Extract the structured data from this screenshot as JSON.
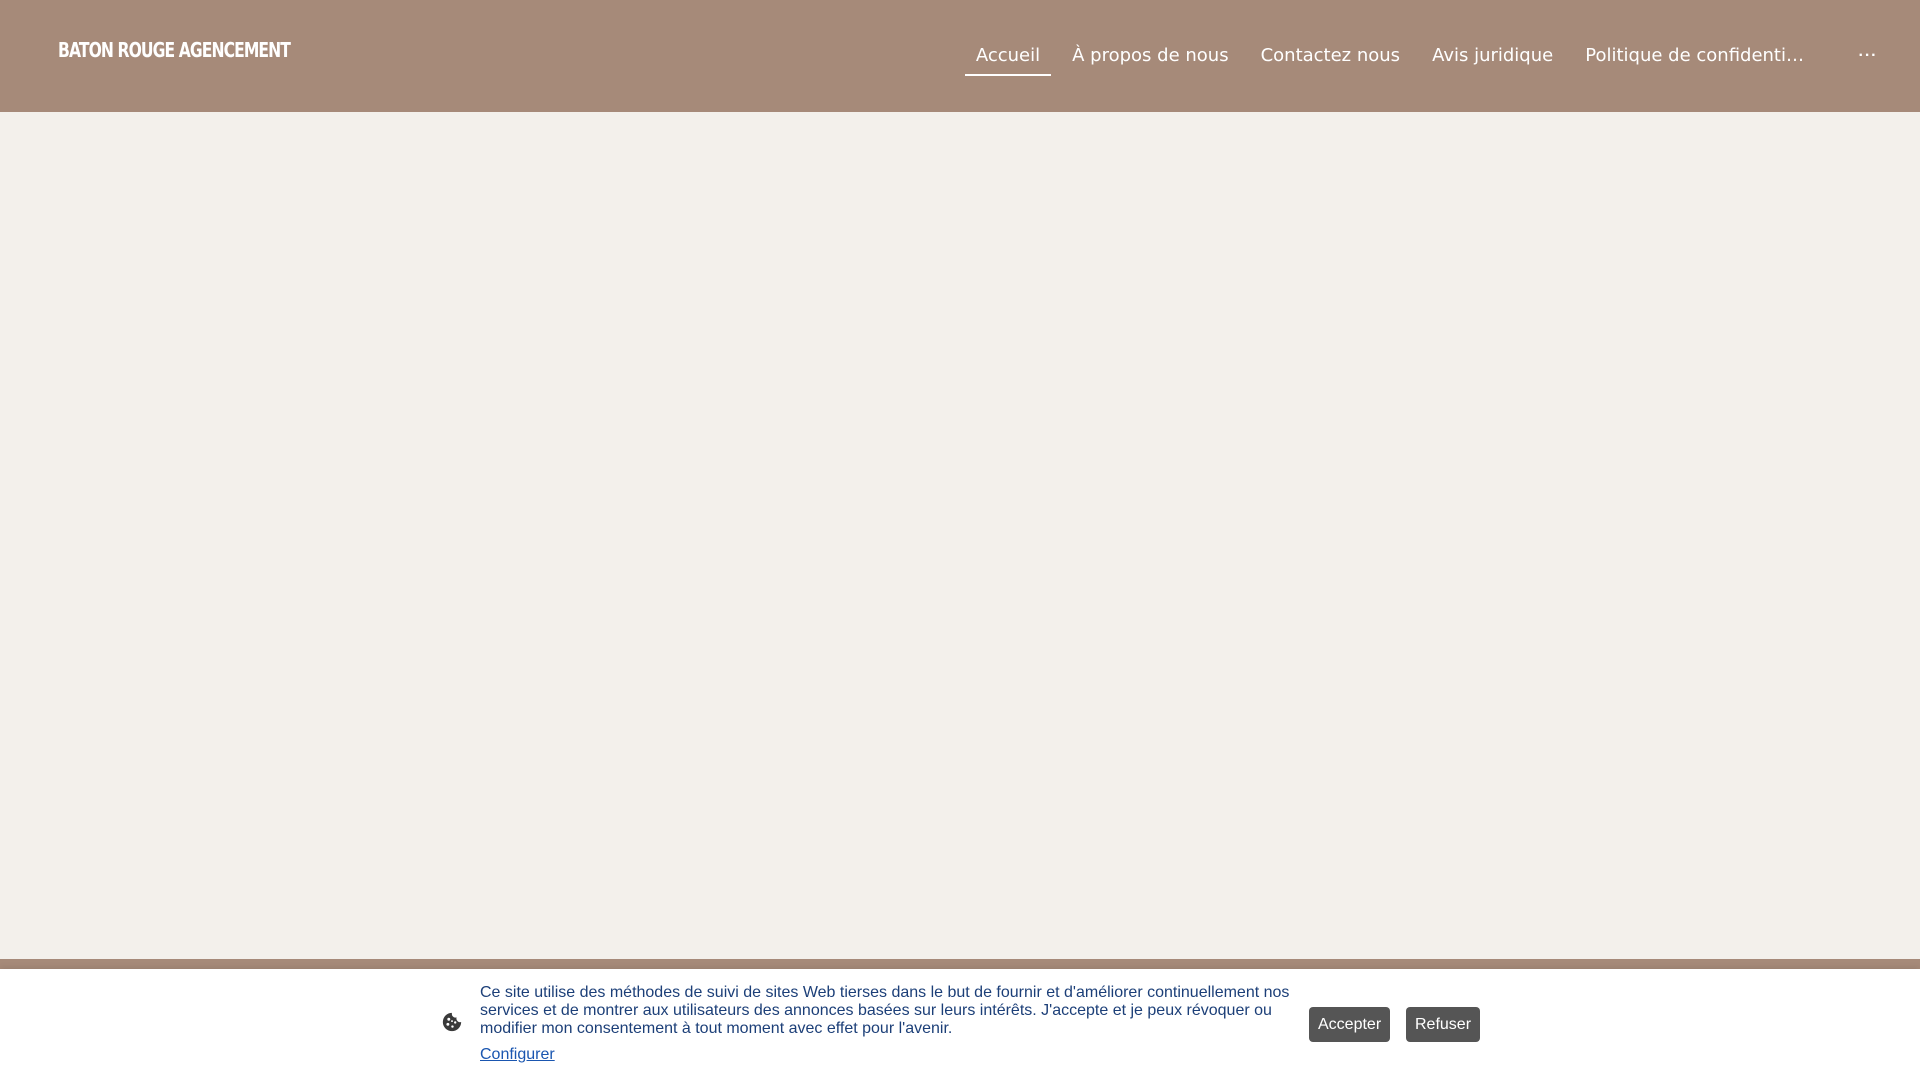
{
  "header": {
    "logo": "Baton Rouge Agencement",
    "nav": [
      {
        "label": "Accueil",
        "active": true
      },
      {
        "label": "À propos de nous",
        "active": false
      },
      {
        "label": "Contactez nous",
        "active": false
      },
      {
        "label": "Avis juridique",
        "active": false
      },
      {
        "label": "Politique de confidenti…",
        "active": false
      }
    ],
    "more_label": "···"
  },
  "cookie": {
    "icon": "cookie-icon",
    "text": "Ce site utilise des méthodes de suivi de sites Web tierses dans le but de fournir et d'améliorer continuellement nos services et de montrer aux utilisateurs des annonces basées sur leurs intérêts. J'accepte et je peux révoquer ou modifier mon consentement à tout moment avec effet pour l'avenir.",
    "configure_label": "Configurer",
    "accept_label": "Accepter",
    "refuse_label": "Refuser"
  },
  "colors": {
    "header_bg": "#a68a79",
    "page_bg": "#f3f0eb",
    "cookie_text": "#1c3f78",
    "button_bg": "#555555"
  }
}
